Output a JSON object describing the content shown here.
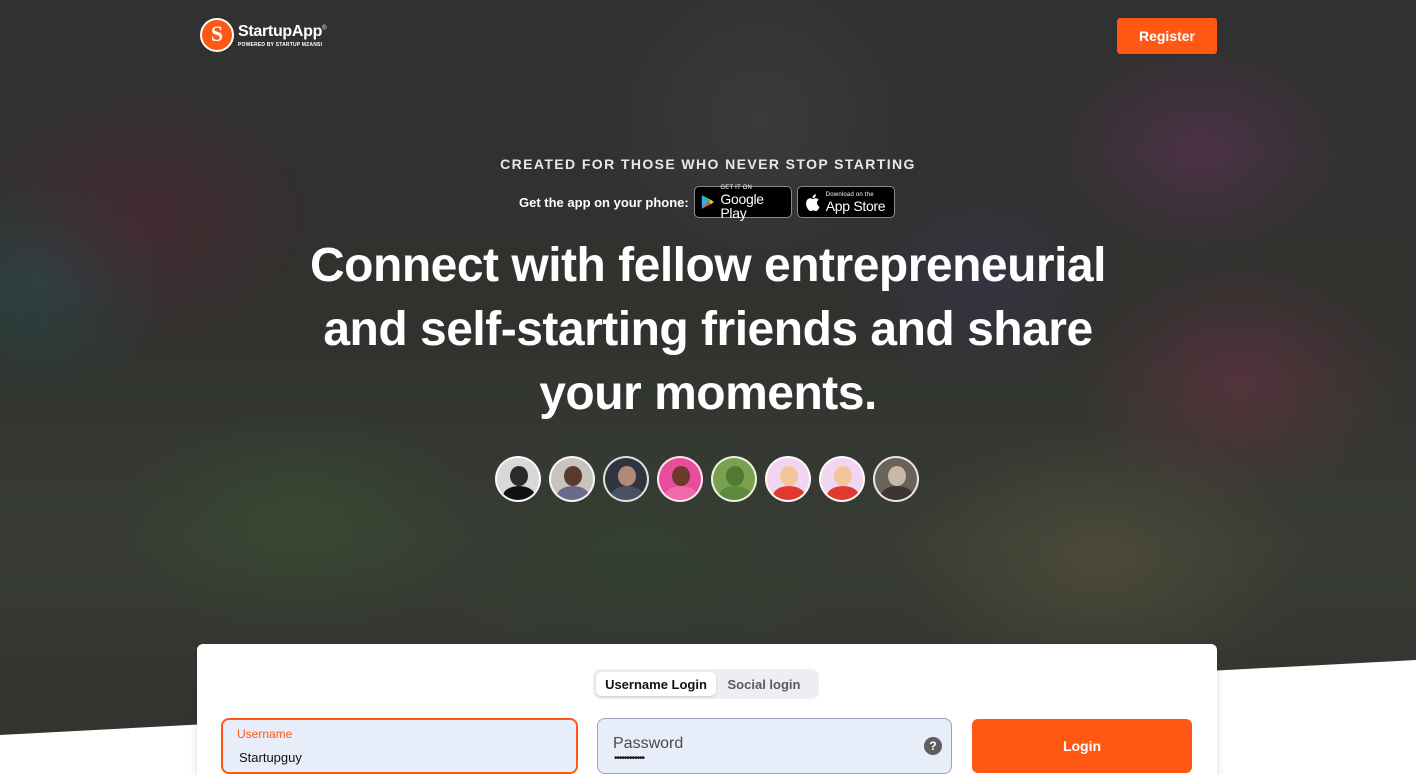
{
  "header": {
    "logo_name": "StartupApp",
    "logo_trademark": "®",
    "logo_sub": "POWERED BY STARTUP MZANSI",
    "logo_letter": "S",
    "register_label": "Register"
  },
  "hero": {
    "tagline": "CREATED FOR THOSE WHO NEVER STOP STARTING",
    "app_label": "Get the app on your phone:",
    "google_play": {
      "small": "GET IT ON",
      "big": "Google Play"
    },
    "app_store": {
      "small": "Download on the",
      "big": "App Store"
    },
    "headline_lines": [
      "Connect with fellow entrepreneurial",
      "and self-starting friends and share",
      "your moments."
    ],
    "avatars": [
      {
        "name": "avatar-1",
        "bg": "#d8d8d8",
        "face": "#2a2a2a",
        "body": "#111111"
      },
      {
        "name": "avatar-2",
        "bg": "#c9c3bd",
        "face": "#5a3a2a",
        "body": "#6a6a8a"
      },
      {
        "name": "avatar-3",
        "bg": "#2e3440",
        "face": "#b08a76",
        "body": "#4a5262"
      },
      {
        "name": "avatar-4",
        "bg": "#e84d9b",
        "face": "#6b3a28",
        "body": "#f06aa9"
      },
      {
        "name": "avatar-5",
        "bg": "#7aa14e",
        "face": "#4e7a32",
        "body": "#5c8a3a"
      },
      {
        "name": "avatar-6",
        "bg": "#f0d6f0",
        "face": "#f4c59a",
        "body": "#e0392f"
      },
      {
        "name": "avatar-7",
        "bg": "#f0d6f0",
        "face": "#f4c59a",
        "body": "#e0392f"
      },
      {
        "name": "avatar-8",
        "bg": "#6a6158",
        "face": "#c8b8a8",
        "body": "#3c3530"
      }
    ]
  },
  "login": {
    "tabs": [
      {
        "label": "Username Login",
        "active": true
      },
      {
        "label": "Social login",
        "active": false
      }
    ],
    "username": {
      "label": "Username",
      "value": "Startupguy"
    },
    "password": {
      "label": "Password",
      "masked": "••••••••••••"
    },
    "help_symbol": "?",
    "login_label": "Login"
  },
  "colors": {
    "accent": "#ff5714",
    "input_bg": "#e8edfa"
  }
}
